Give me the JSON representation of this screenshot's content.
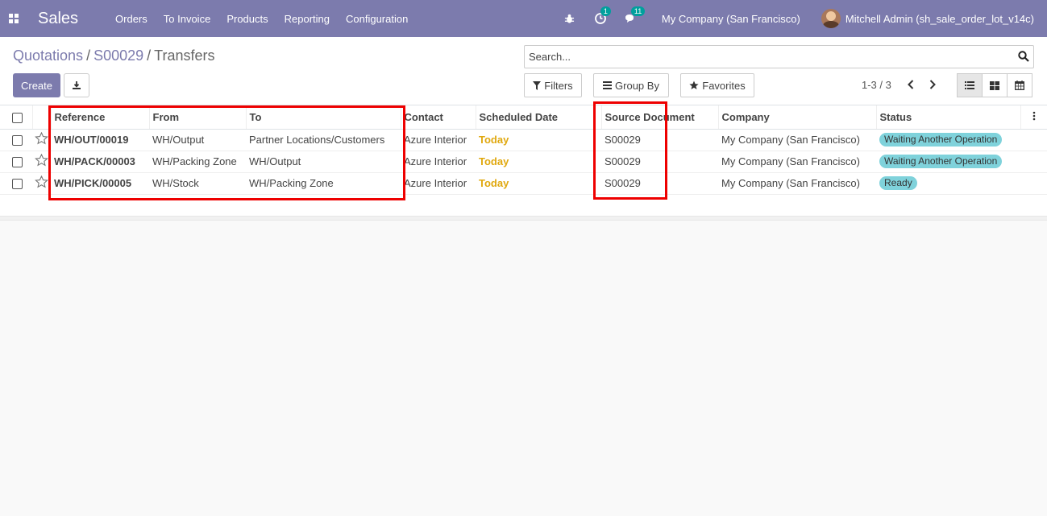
{
  "navbar": {
    "app_name": "Sales",
    "menu": [
      "Orders",
      "To Invoice",
      "Products",
      "Reporting",
      "Configuration"
    ],
    "activity_count": "1",
    "messages_count": "11",
    "company": "My Company (San Francisco)",
    "user": "Mitchell Admin (sh_sale_order_lot_v14c)",
    "bar_color": "#7c7bad"
  },
  "breadcrumb": {
    "items": [
      "Quotations",
      "S00029",
      "Transfers"
    ],
    "separator": "/"
  },
  "toolbar": {
    "create_label": "Create",
    "search_placeholder": "Search...",
    "filters_label": "Filters",
    "groupby_label": "Group By",
    "favorites_label": "Favorites",
    "pager": "1-3 / 3"
  },
  "table": {
    "headers": [
      "Reference",
      "From",
      "To",
      "Contact",
      "Scheduled Date",
      "Source Document",
      "Company",
      "Status"
    ],
    "rows": [
      {
        "reference": "WH/OUT/00019",
        "from": "WH/Output",
        "to": "Partner Locations/Customers",
        "contact": "Azure Interior",
        "scheduled": "Today",
        "source": "S00029",
        "company": "My Company (San Francisco)",
        "status": "Waiting Another Operation"
      },
      {
        "reference": "WH/PACK/00003",
        "from": "WH/Packing Zone",
        "to": "WH/Output",
        "contact": "Azure Interior",
        "scheduled": "Today",
        "source": "S00029",
        "company": "My Company (San Francisco)",
        "status": "Waiting Another Operation"
      },
      {
        "reference": "WH/PICK/00005",
        "from": "WH/Stock",
        "to": "WH/Packing Zone",
        "contact": "Azure Interior",
        "scheduled": "Today",
        "source": "S00029",
        "company": "My Company (San Francisco)",
        "status": "Ready"
      }
    ]
  },
  "colors": {
    "today": "#e0a80e",
    "status_badge": "#7fd2db",
    "highlight": "#ee0000"
  }
}
